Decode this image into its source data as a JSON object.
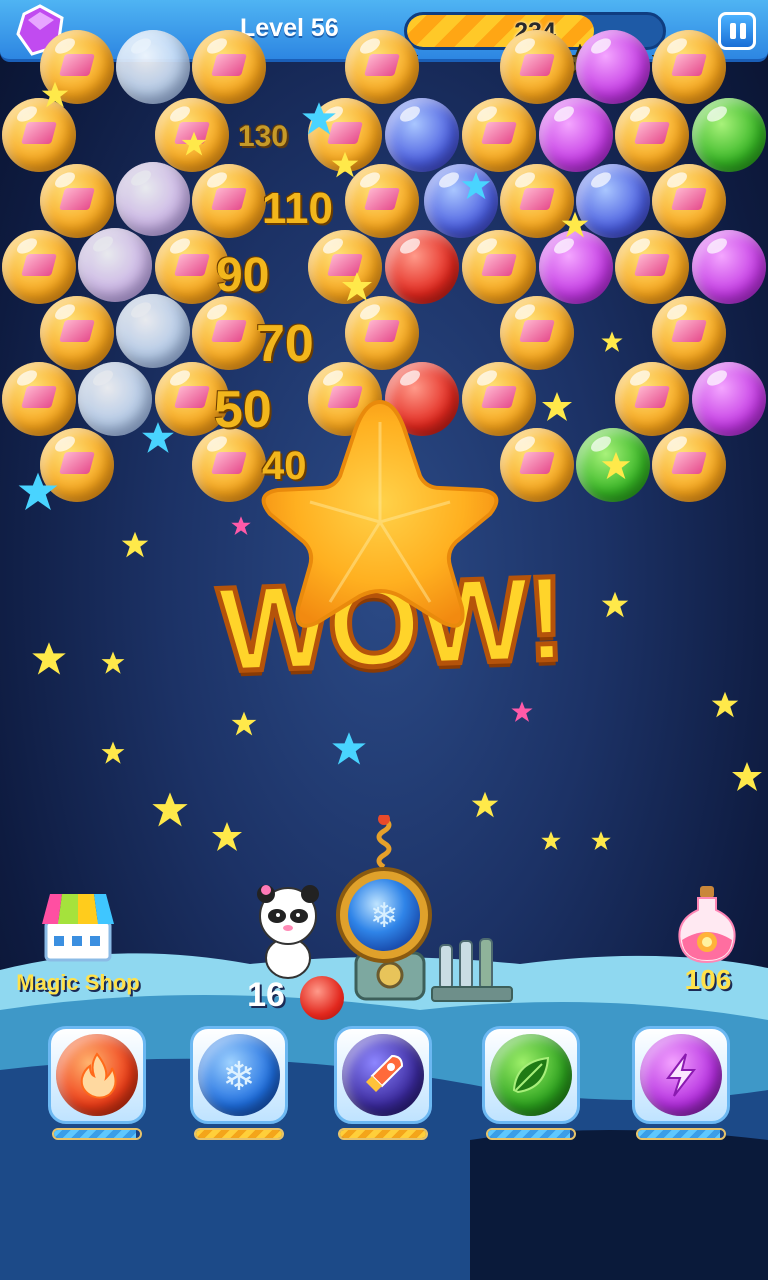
{
  "header": {
    "level_label": "Level 56",
    "score": "234",
    "score_progress": 0.73,
    "stars_earned": 0
  },
  "effects": {
    "points": [
      "130",
      "110",
      "90",
      "70",
      "50",
      "40"
    ],
    "banner": "WOW!"
  },
  "shop": {
    "label": "Magic Shop"
  },
  "shooter": {
    "shots_left": "16",
    "next_bubble_color": "red",
    "current_bubble": "ice"
  },
  "potion": {
    "count": "106"
  },
  "boosters": [
    {
      "name": "fire",
      "color": "#e8361a",
      "icon": "fire-icon",
      "charge": 0.95
    },
    {
      "name": "ice",
      "color": "#1f6fe0",
      "icon": "snowflake-icon",
      "charge": 1.0
    },
    {
      "name": "rocket",
      "color": "#3b2a9e",
      "icon": "rocket-icon",
      "charge": 1.0
    },
    {
      "name": "leaf",
      "color": "#2da41f",
      "icon": "leaf-icon",
      "charge": 0.95
    },
    {
      "name": "lightning",
      "color": "#b52fe0",
      "icon": "lightning-icon",
      "charge": 0.95
    }
  ],
  "colors": {
    "topbar": "#3a9cec",
    "gold_text": "#ffe14a",
    "sky": "#1c3266"
  }
}
